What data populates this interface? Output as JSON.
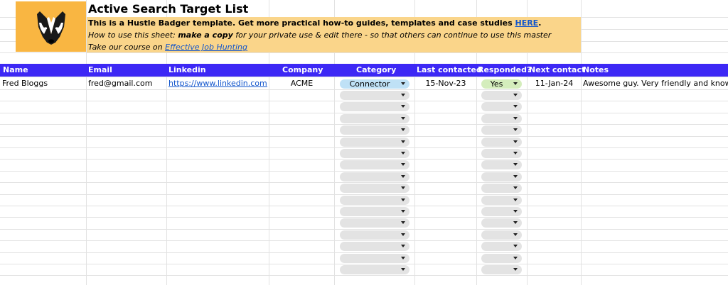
{
  "sheet": {
    "title": "Active Search Target List",
    "info": {
      "line1_text": "This is a Hustle Badger template. Get more practical how-to guides, templates and case studies ",
      "line1_link": "HERE",
      "line1_end": ".",
      "line2_pre": "How to use this sheet: ",
      "line2_bold": "make a copy",
      "line2_post": " for your private use & edit there - so that others can continue to use this master",
      "line3_pre": "Take our course on ",
      "line3_link": "Effective Job Hunting"
    },
    "logo_icon": "badger-icon",
    "colors": {
      "header_bg": "#3d28f5",
      "logo_bg": "#f9b642",
      "info_bg": "#fad58a",
      "connector_chip": "#bfe1f6",
      "yes_chip": "#d4edbc",
      "empty_chip": "#e3e3e3"
    }
  },
  "columns": [
    "Name",
    "Email",
    "Linkedin",
    "Company",
    "Category",
    "Last contacted",
    "Responded?",
    "Next contact",
    "Notes"
  ],
  "rows": [
    {
      "name": "Fred Bloggs",
      "email": "fred@gmail.com",
      "linkedin": "https://www.linkedin.com/",
      "company": "ACME",
      "category": "Connector",
      "last_contacted": "15-Nov-23",
      "responded": "Yes",
      "next_contact": "11-Jan-24",
      "notes": "Awesome guy. Very friendly and knowle"
    }
  ]
}
